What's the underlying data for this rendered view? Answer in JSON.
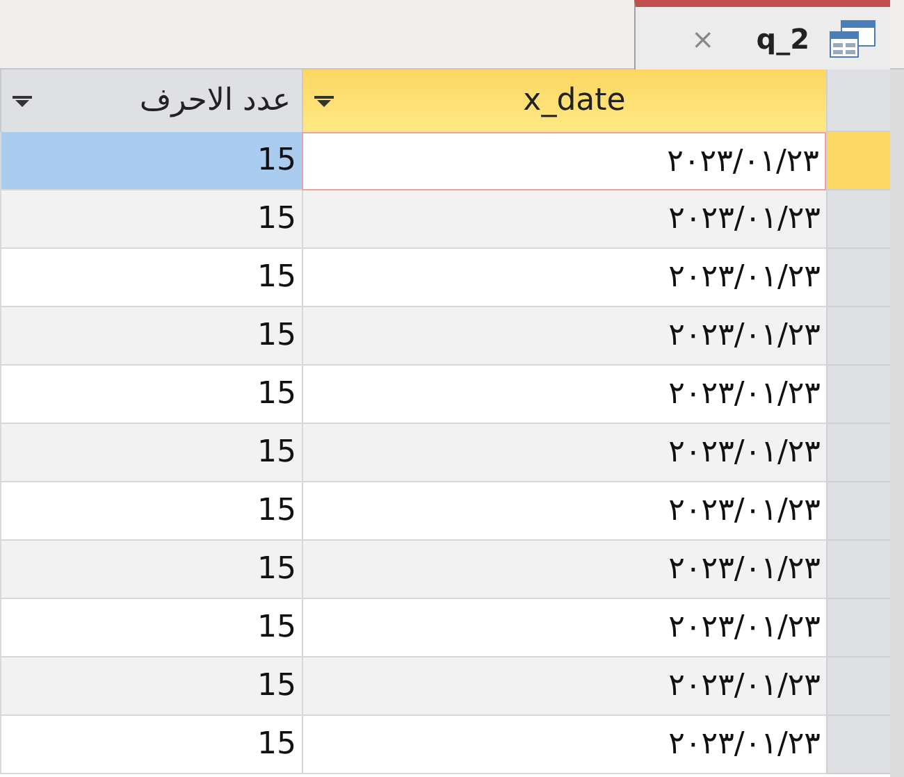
{
  "tabs": [
    {
      "title": "q_2",
      "selected": true,
      "close": "×"
    }
  ],
  "columns": [
    {
      "label": "x_date",
      "active": true
    },
    {
      "label": "عدد الاحرف",
      "active": false
    }
  ],
  "rows": [
    {
      "x_date": "٢٠٢٣/٠١/٢٣",
      "count": "15",
      "selected": true
    },
    {
      "x_date": "٢٠٢٣/٠١/٢٣",
      "count": "15",
      "selected": false
    },
    {
      "x_date": "٢٠٢٣/٠١/٢٣",
      "count": "15",
      "selected": false
    },
    {
      "x_date": "٢٠٢٣/٠١/٢٣",
      "count": "15",
      "selected": false
    },
    {
      "x_date": "٢٠٢٣/٠١/٢٣",
      "count": "15",
      "selected": false
    },
    {
      "x_date": "٢٠٢٣/٠١/٢٣",
      "count": "15",
      "selected": false
    },
    {
      "x_date": "٢٠٢٣/٠١/٢٣",
      "count": "15",
      "selected": false
    },
    {
      "x_date": "٢٠٢٣/٠١/٢٣",
      "count": "15",
      "selected": false
    },
    {
      "x_date": "٢٠٢٣/٠١/٢٣",
      "count": "15",
      "selected": false
    },
    {
      "x_date": "٢٠٢٣/٠١/٢٣",
      "count": "15",
      "selected": false
    },
    {
      "x_date": "٢٠٢٣/٠١/٢٣",
      "count": "15",
      "selected": false
    }
  ]
}
